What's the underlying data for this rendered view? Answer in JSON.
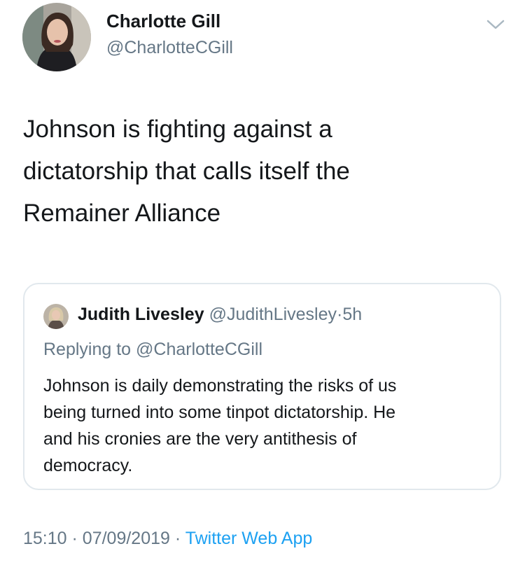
{
  "tweet": {
    "author_name": "Charlotte Gill",
    "author_handle": "@CharlotteCGill",
    "text": "Johnson is fighting against a\ndictatorship that calls itself the\nRemainer Alliance",
    "time": "15:10",
    "date": "07/09/2019",
    "separator": "·",
    "source": "Twitter Web App",
    "menu_icon": "chevron-down-icon"
  },
  "quote": {
    "author_name": "Judith Livesley",
    "author_handle": "@JudithLivesley",
    "separator": "·",
    "time_ago": "5h",
    "replying_to": "Replying to @CharlotteCGill",
    "text": "Johnson is daily demonstrating the risks of us\nbeing turned into some tinpot dictatorship. He\nand his cronies are the very antithesis of\ndemocracy."
  },
  "colors": {
    "text_primary": "#14171a",
    "text_secondary": "#657786",
    "link": "#1da1f2",
    "border": "#e1e8ed"
  }
}
